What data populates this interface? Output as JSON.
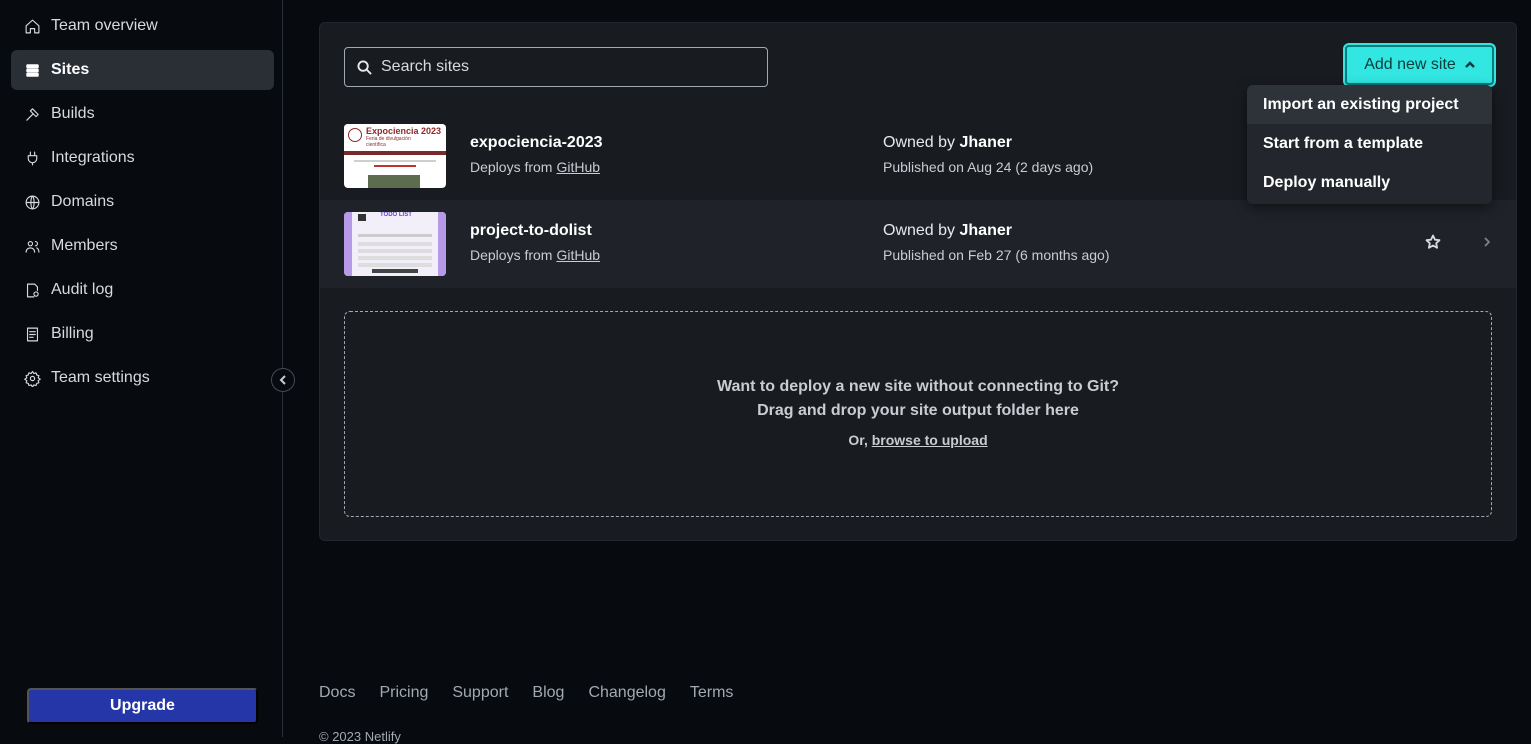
{
  "sidebar": {
    "items": [
      {
        "label": "Team overview",
        "icon": "home-icon",
        "active": false
      },
      {
        "label": "Sites",
        "icon": "layers-icon",
        "active": true
      },
      {
        "label": "Builds",
        "icon": "hammer-icon",
        "active": false
      },
      {
        "label": "Integrations",
        "icon": "plug-icon",
        "active": false
      },
      {
        "label": "Domains",
        "icon": "globe-icon",
        "active": false
      },
      {
        "label": "Members",
        "icon": "users-icon",
        "active": false
      },
      {
        "label": "Audit log",
        "icon": "audit-icon",
        "active": false
      },
      {
        "label": "Billing",
        "icon": "receipt-icon",
        "active": false
      },
      {
        "label": "Team settings",
        "icon": "gear-icon",
        "active": false
      }
    ],
    "upgrade_label": "Upgrade"
  },
  "toolbar": {
    "search_placeholder": "Search sites",
    "add_new_site_label": "Add new site"
  },
  "dropdown": {
    "items": [
      "Import an existing project",
      "Start from a template",
      "Deploy manually"
    ]
  },
  "sites": [
    {
      "name": "expociencia-2023",
      "deploys_prefix": "Deploys from",
      "deploys_source": "GitHub",
      "owned_prefix": "Owned by",
      "owner": "Jhaner",
      "published": "Published on Aug 24 (2 days ago)",
      "thumb_title": "Expociencia 2023",
      "thumb_sub": "Feria de divulgación científica"
    },
    {
      "name": "project-to-dolist",
      "deploys_prefix": "Deploys from",
      "deploys_source": "GitHub",
      "owned_prefix": "Owned by",
      "owner": "Jhaner",
      "published": "Published on Feb 27 (6 months ago)",
      "thumb_title": "TODO LIST"
    }
  ],
  "dropzone": {
    "line1": "Want to deploy a new site without connecting to Git?",
    "line2": "Drag and drop your site output folder here",
    "or_prefix": "Or,",
    "browse_link": "browse to upload"
  },
  "footer": {
    "links": [
      "Docs",
      "Pricing",
      "Support",
      "Blog",
      "Changelog",
      "Terms"
    ],
    "copyright": "© 2023 Netlify"
  },
  "colors": {
    "accent": "#32e6e2",
    "upgrade": "#2536a8",
    "panel": "#181b20",
    "background": "#070a0e"
  }
}
